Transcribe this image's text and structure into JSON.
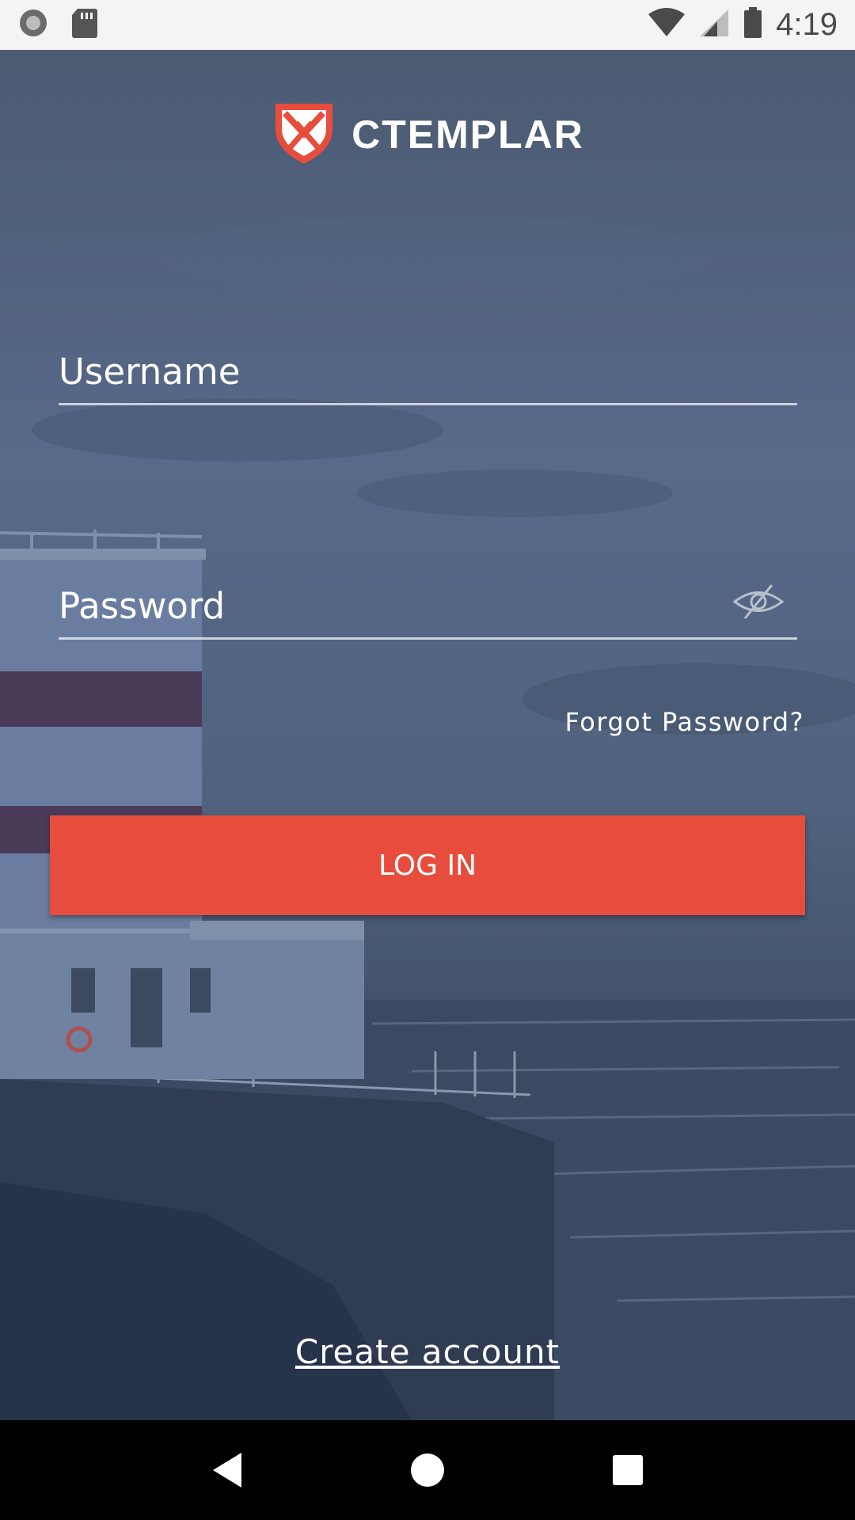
{
  "status_bar": {
    "time": "4:19",
    "icons": [
      "circle-notification-icon",
      "sd-card-icon",
      "wifi-icon",
      "cell-signal-icon",
      "battery-icon"
    ]
  },
  "app": {
    "brand_name": "CTEMPLAR",
    "brand_color": "#e74c3c"
  },
  "login_form": {
    "username_placeholder": "Username",
    "password_placeholder": "Password",
    "password_visibility_icon": "eye-off-icon",
    "forgot_password_label": "Forgot Password?",
    "login_button_label": "LOG IN",
    "create_account_label": "Create account"
  },
  "nav_bar": {
    "buttons": [
      "back-icon",
      "home-icon",
      "recents-icon"
    ]
  }
}
